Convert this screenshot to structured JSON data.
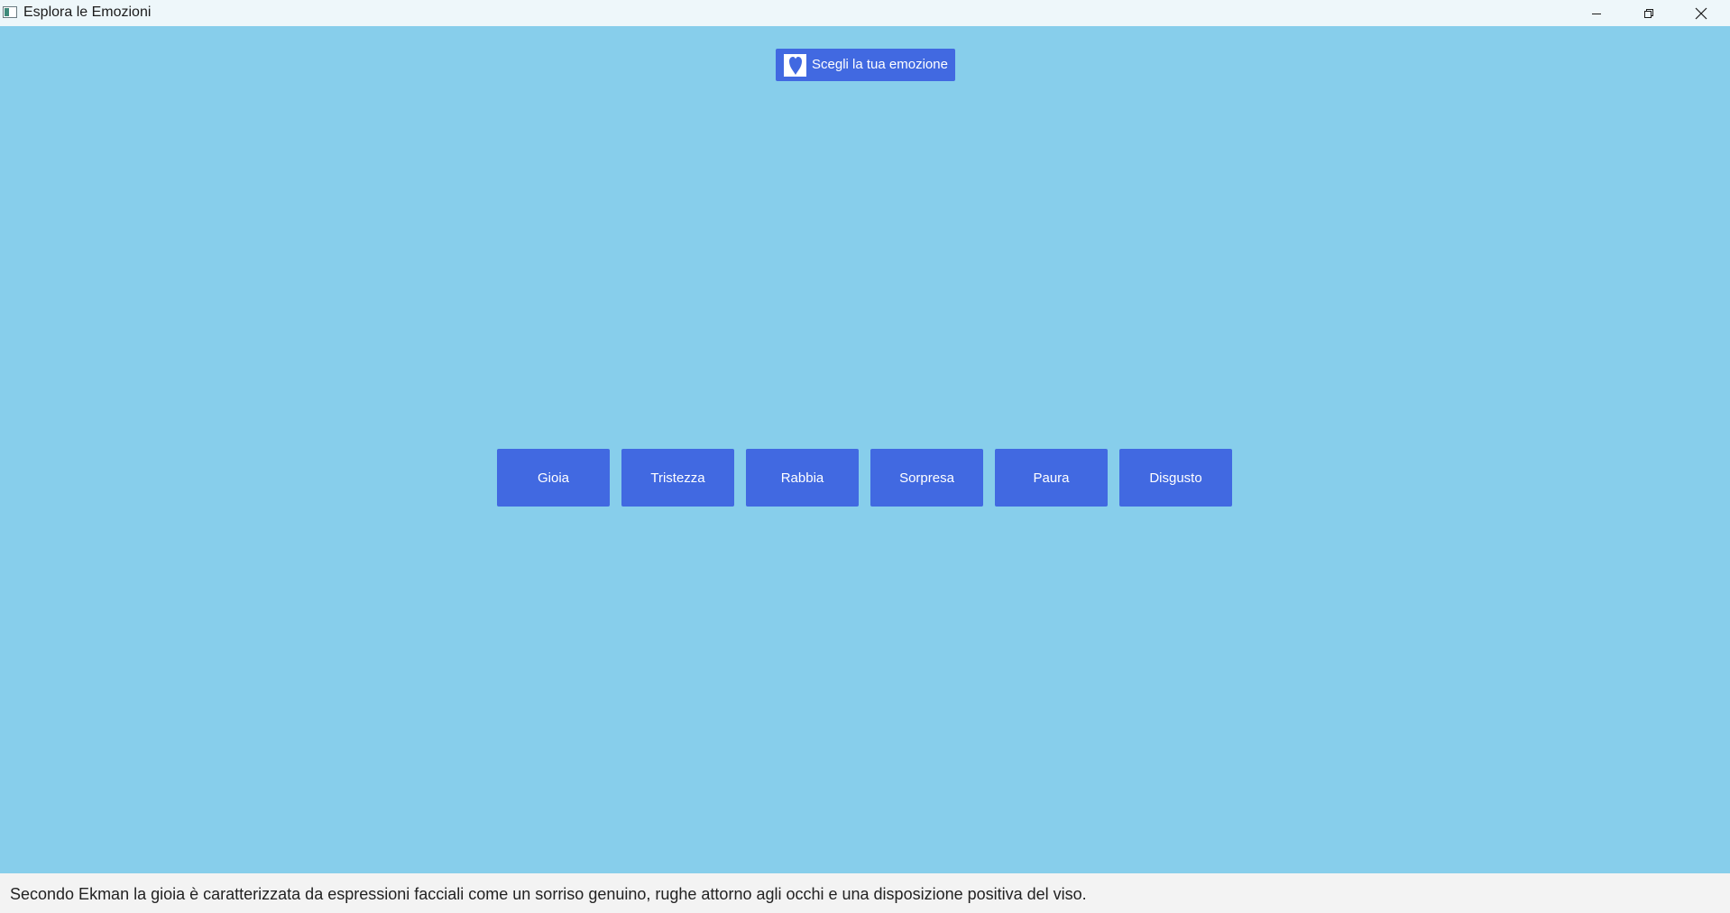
{
  "window": {
    "title": "Esplora le Emozioni",
    "icons": {
      "app": "app-window-icon",
      "minimize": "minimize-icon",
      "maximize": "restore-icon",
      "close": "close-icon"
    }
  },
  "header": {
    "choose_label": "Scegli la tua emozione",
    "choose_icon": "heart-icon"
  },
  "emotions": [
    "Gioia",
    "Tristezza",
    "Rabbia",
    "Sorpresa",
    "Paura",
    "Disgusto"
  ],
  "description": "Secondo Ekman la gioia è caratterizzata da espressioni facciali come un sorriso genuino, rughe attorno agli occhi e una disposizione positiva del viso.",
  "colors": {
    "background": "#87ceeb",
    "button": "#4169e1",
    "button_text": "#ffffff"
  }
}
